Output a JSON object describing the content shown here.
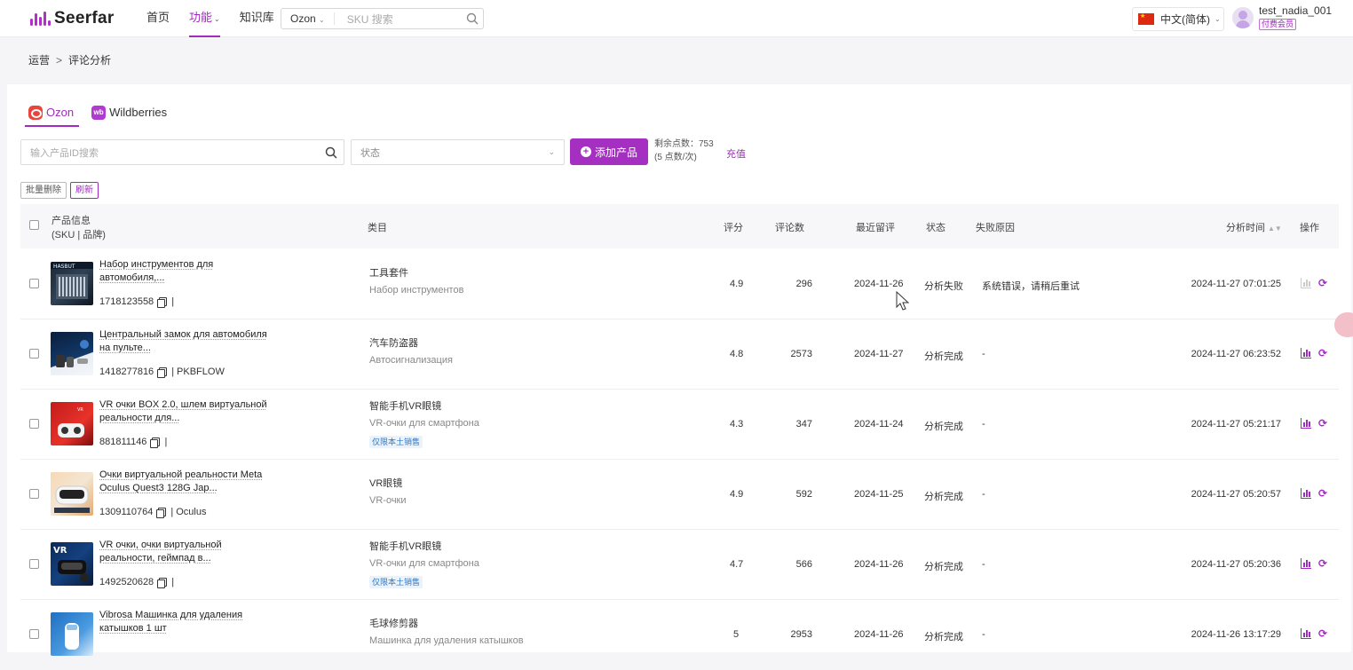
{
  "app": {
    "brand": "Seerfar"
  },
  "nav": {
    "items": [
      "首页",
      "功能",
      "知识库"
    ],
    "active_index": 1
  },
  "top_search": {
    "platform": "Ozon",
    "placeholder": "SKU 搜索"
  },
  "language": {
    "label": "中文(简体)"
  },
  "user": {
    "name": "test_nadia_001",
    "badge": "付费会员"
  },
  "breadcrumb": {
    "parent": "运营",
    "separator": ">",
    "current": "评论分析"
  },
  "tabs": [
    {
      "label": "Ozon",
      "active": true
    },
    {
      "label": "Wildberries",
      "active": false
    }
  ],
  "toolbar": {
    "search_placeholder": "输入产品ID搜索",
    "status_placeholder": "状态",
    "add_label": "添加产品",
    "points_line1": "剩余点数：753",
    "points_line2": "(5 点数/次)",
    "recharge": "充值",
    "bulk_delete": "批量删除",
    "refresh": "刷新"
  },
  "table": {
    "headers": {
      "product_line1": "产品信息",
      "product_line2": "(SKU | 品牌)",
      "category": "类目",
      "rating": "评分",
      "reviews": "评论数",
      "latest": "最近留评",
      "status": "状态",
      "reason": "失败原因",
      "time": "分析时间",
      "action": "操作"
    },
    "rows": [
      {
        "name": "Набор инструментов для автомобиля,...",
        "sku": "1718123558",
        "brand": "",
        "cat_cn": "工具套件",
        "cat_ru": "Набор инструментов",
        "tag": "",
        "rating": "4.9",
        "reviews": "296",
        "latest": "2024-11-26",
        "status": "分析失败",
        "reason": "系统错误，请稍后重试",
        "time": "2024-11-27 07:01:25"
      },
      {
        "name": "Центральный замок для автомобиля на пульте...",
        "sku": "1418277816",
        "brand": "PKBFLOW",
        "cat_cn": "汽车防盗器",
        "cat_ru": "Автосигнализация",
        "tag": "",
        "rating": "4.8",
        "reviews": "2573",
        "latest": "2024-11-27",
        "status": "分析完成",
        "reason": "-",
        "time": "2024-11-27 06:23:52"
      },
      {
        "name": "VR очки BOX 2.0, шлем виртуальной реальности для...",
        "sku": "881811146",
        "brand": "",
        "cat_cn": "智能手机VR眼镜",
        "cat_ru": "VR-очки для смартфона",
        "tag": "仅限本土销售",
        "rating": "4.3",
        "reviews": "347",
        "latest": "2024-11-24",
        "status": "分析完成",
        "reason": "-",
        "time": "2024-11-27 05:21:17"
      },
      {
        "name": "Очки виртуальной реальности Meta Oculus Quest3 128G Jap...",
        "sku": "1309110764",
        "brand": "Oculus",
        "cat_cn": "VR眼镜",
        "cat_ru": "VR-очки",
        "tag": "",
        "rating": "4.9",
        "reviews": "592",
        "latest": "2024-11-25",
        "status": "分析完成",
        "reason": "-",
        "time": "2024-11-27 05:20:57"
      },
      {
        "name": "VR очки, очки виртуальной реальности, геймпад в...",
        "sku": "1492520628",
        "brand": "",
        "cat_cn": "智能手机VR眼镜",
        "cat_ru": "VR-очки для смартфона",
        "tag": "仅限本土销售",
        "rating": "4.7",
        "reviews": "566",
        "latest": "2024-11-26",
        "status": "分析完成",
        "reason": "-",
        "time": "2024-11-27 05:20:36"
      },
      {
        "name": "Vibrosa Машинка для удаления катышков 1 шт",
        "sku": "",
        "brand": "",
        "cat_cn": "毛球修剪器",
        "cat_ru": "Машинка для удаления катышков",
        "tag": "",
        "rating": "5",
        "reviews": "2953",
        "latest": "2024-11-26",
        "status": "分析完成",
        "reason": "-",
        "time": "2024-11-26 13:17:29"
      }
    ]
  },
  "colors": {
    "accent": "#a22bbf",
    "button": "#a52fc1",
    "tag_text": "#2f79c8"
  }
}
